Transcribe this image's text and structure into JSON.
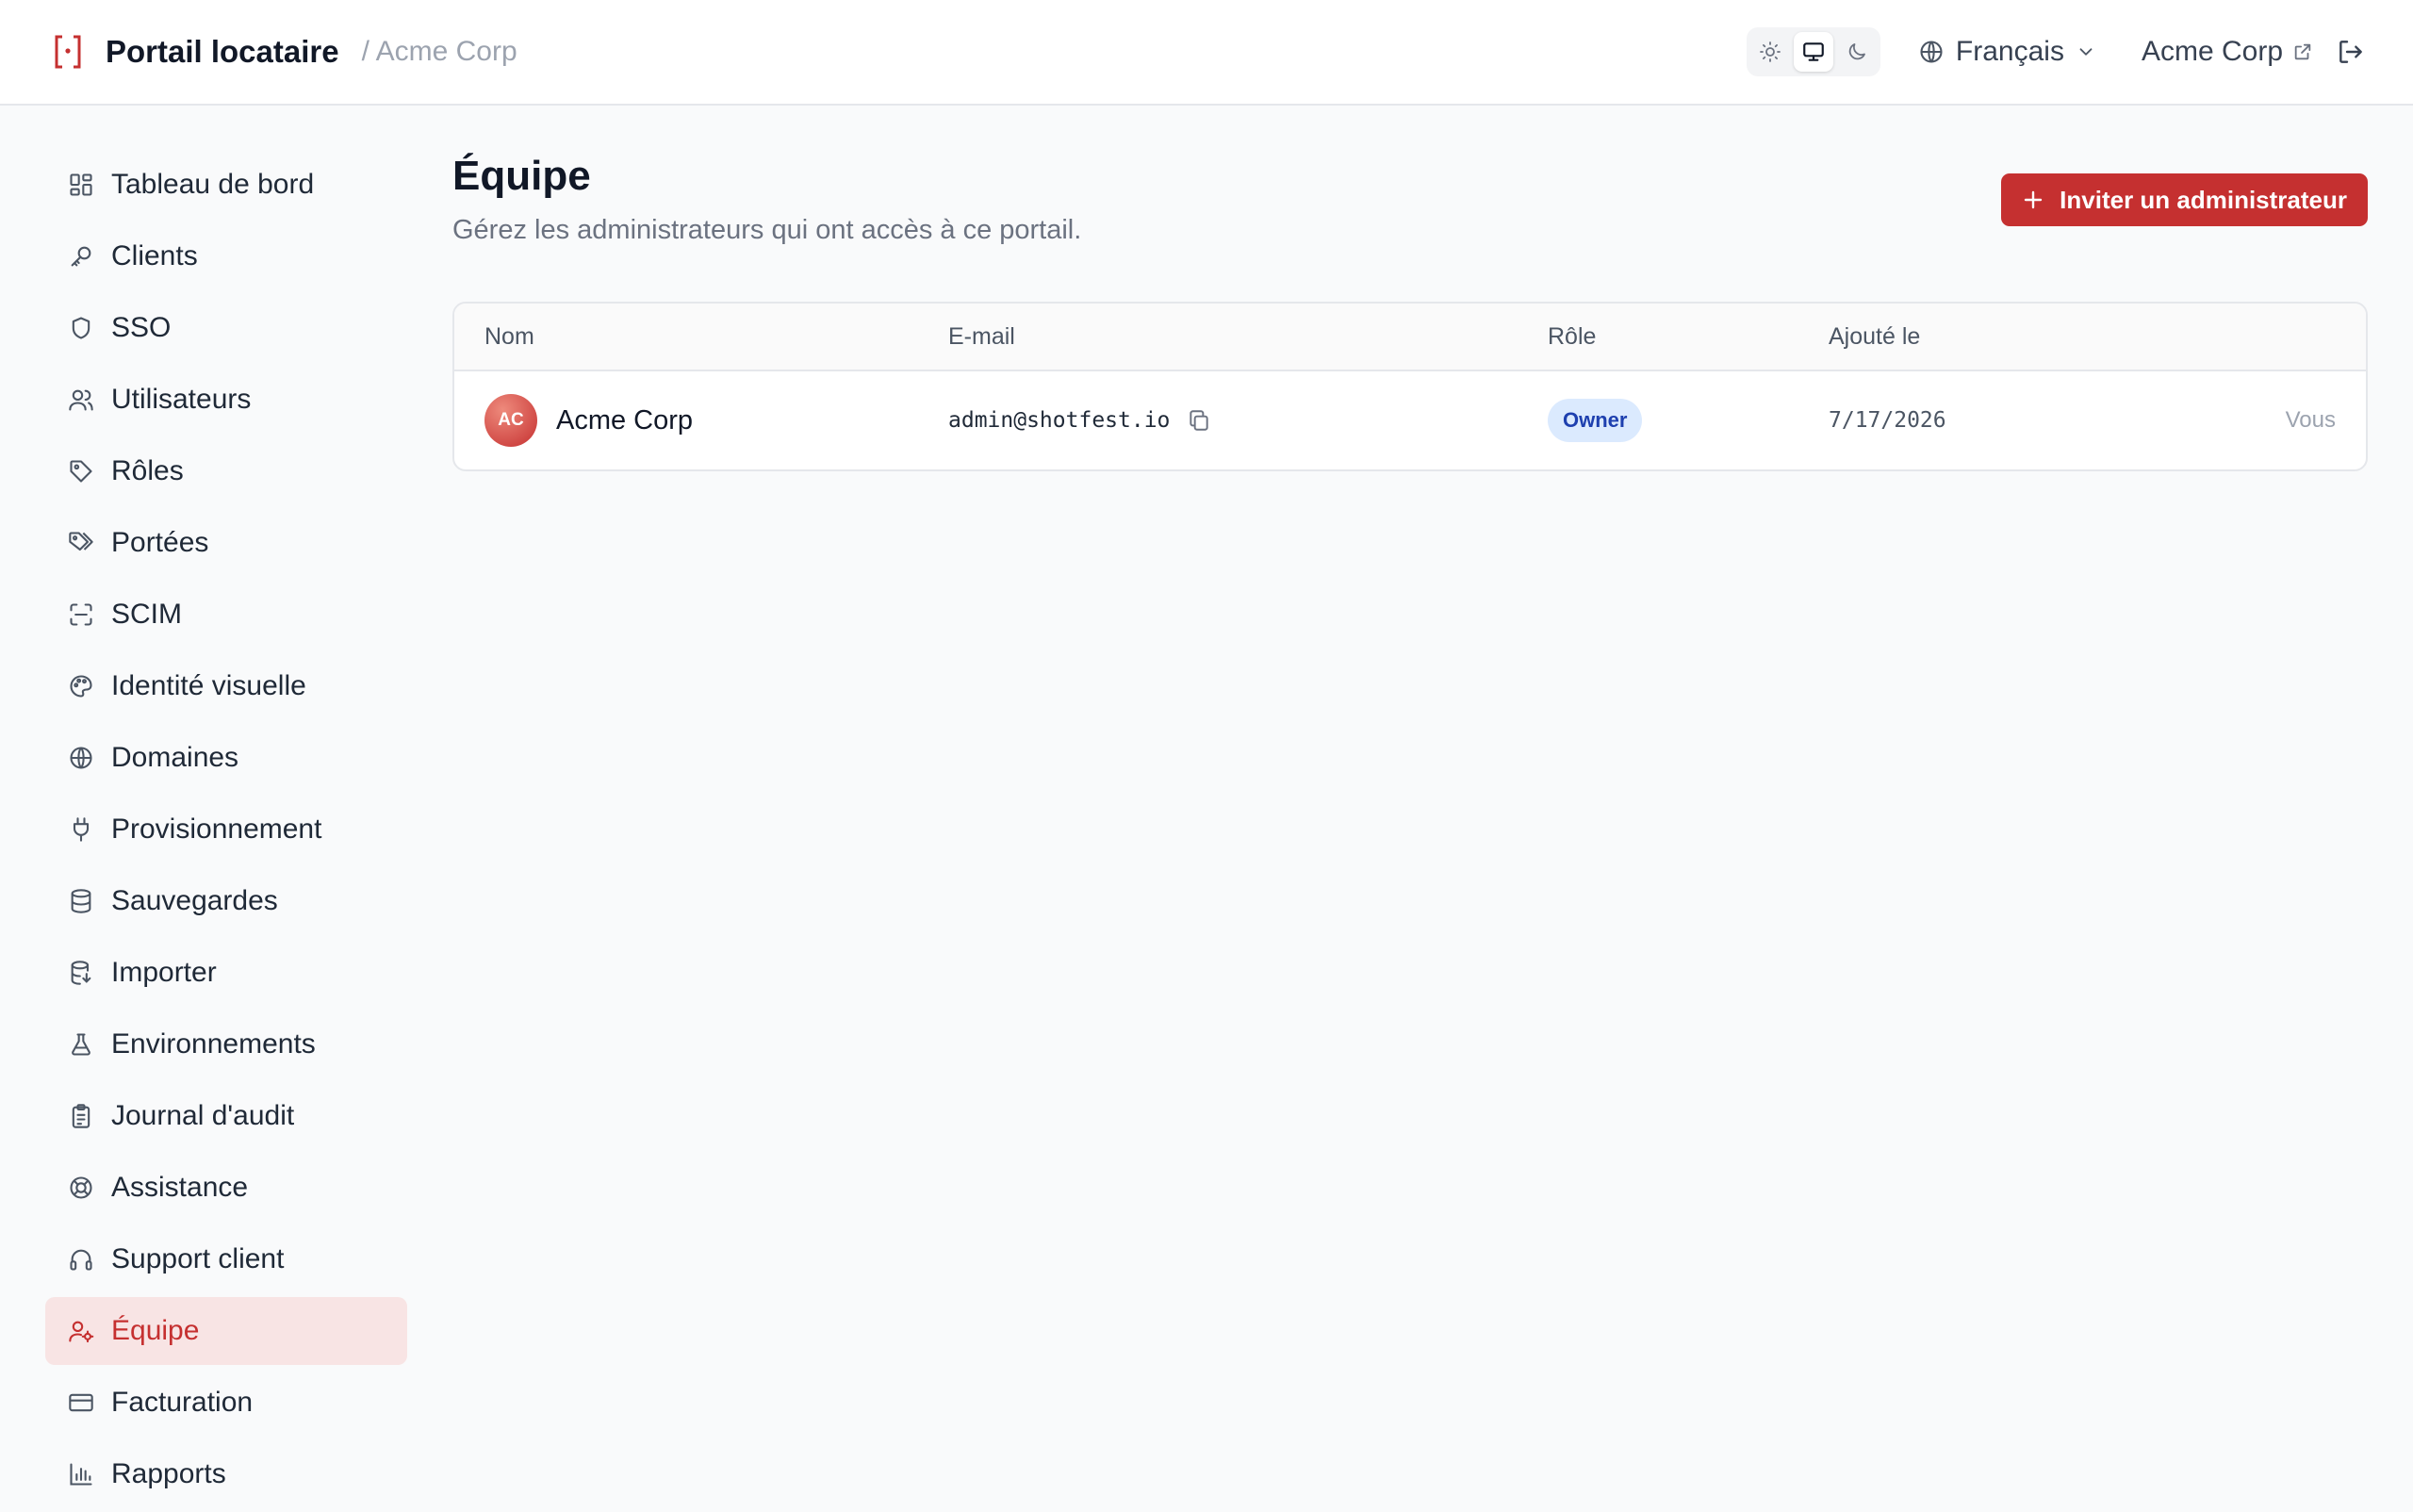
{
  "header": {
    "title": "Portail locataire",
    "breadcrumb": "/ Acme Corp",
    "language": "Français",
    "tenant_link": "Acme Corp",
    "theme_modes": [
      "light",
      "system",
      "dark"
    ],
    "active_theme": "system",
    "accent_color": "#c53030"
  },
  "sidebar": {
    "items": [
      {
        "label": "Tableau de bord",
        "icon": "dashboard-icon"
      },
      {
        "label": "Clients",
        "icon": "key-icon"
      },
      {
        "label": "SSO",
        "icon": "shield-icon"
      },
      {
        "label": "Utilisateurs",
        "icon": "users-icon"
      },
      {
        "label": "Rôles",
        "icon": "tag-icon"
      },
      {
        "label": "Portées",
        "icon": "tags-icon"
      },
      {
        "label": "SCIM",
        "icon": "scan-icon"
      },
      {
        "label": "Identité visuelle",
        "icon": "palette-icon"
      },
      {
        "label": "Domaines",
        "icon": "globe-icon"
      },
      {
        "label": "Provisionnement",
        "icon": "plug-icon"
      },
      {
        "label": "Sauvegardes",
        "icon": "database-icon"
      },
      {
        "label": "Importer",
        "icon": "database-import-icon"
      },
      {
        "label": "Environnements",
        "icon": "flask-icon"
      },
      {
        "label": "Journal d'audit",
        "icon": "clipboard-icon"
      },
      {
        "label": "Assistance",
        "icon": "lifebuoy-icon"
      },
      {
        "label": "Support client",
        "icon": "headphones-icon"
      },
      {
        "label": "Équipe",
        "icon": "user-cog-icon",
        "active": true
      },
      {
        "label": "Facturation",
        "icon": "credit-card-icon"
      },
      {
        "label": "Rapports",
        "icon": "bar-chart-icon"
      }
    ]
  },
  "main": {
    "title": "Équipe",
    "subtitle": "Gérez les administrateurs qui ont accès à ce portail.",
    "invite_label": "Inviter un administrateur",
    "table": {
      "columns": [
        "Nom",
        "E-mail",
        "Rôle",
        "Ajouté le"
      ],
      "rows": [
        {
          "initials": "AC",
          "name": "Acme Corp",
          "email": "admin@shotfest.io",
          "role": "Owner",
          "added": "7/17/2026",
          "action": "Vous"
        }
      ]
    }
  }
}
